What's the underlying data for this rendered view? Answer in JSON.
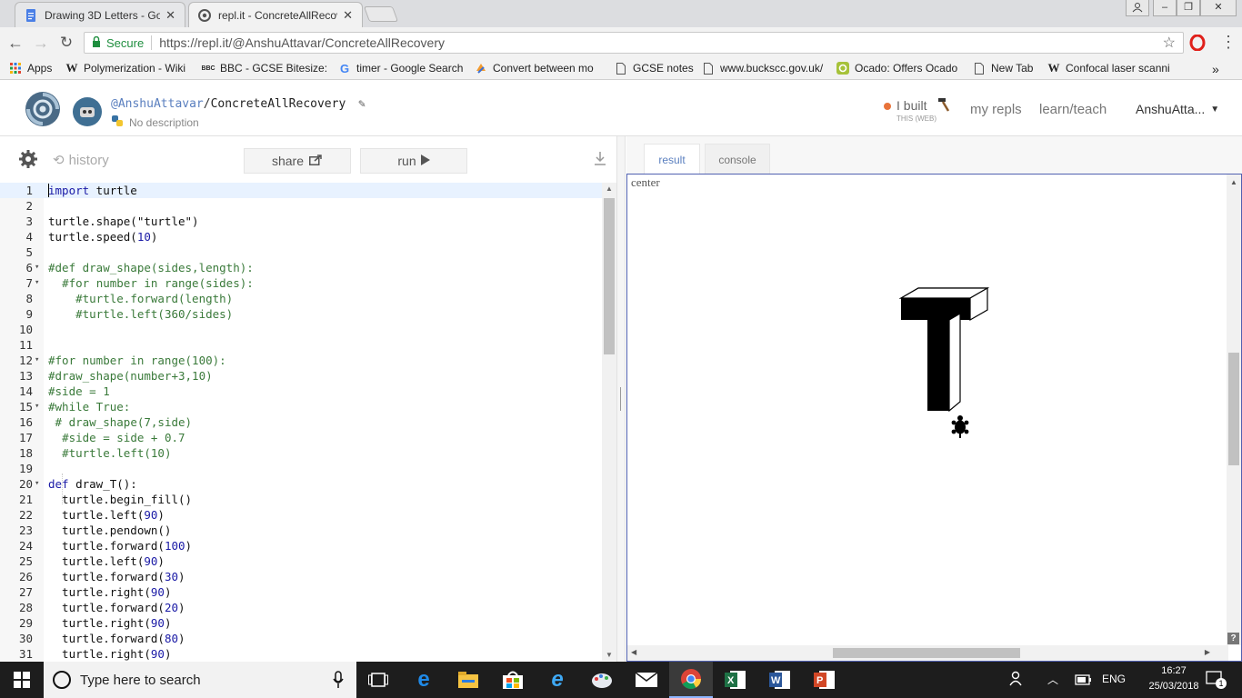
{
  "browser": {
    "tabs": [
      {
        "title": "Drawing 3D Letters - Goc",
        "close": "✕"
      },
      {
        "title": "repl.it - ConcreteAllRecov",
        "close": "✕"
      }
    ],
    "secure_label": "Secure",
    "url": "https://repl.it/@AnshuAttavar/ConcreteAllRecovery",
    "bookmarks": [
      {
        "label": "Apps",
        "icon": "apps-grid-icon"
      },
      {
        "label": "Polymerization - Wiki",
        "icon": "wikipedia-icon"
      },
      {
        "label": "BBC - GCSE Bitesize: I",
        "icon": "bbc-icon"
      },
      {
        "label": "timer - Google Search",
        "icon": "google-icon"
      },
      {
        "label": "Convert between mo",
        "icon": "convert-icon"
      },
      {
        "label": "GCSE notes",
        "icon": "page-icon"
      },
      {
        "label": "www.buckscc.gov.uk/",
        "icon": "page-icon"
      },
      {
        "label": "Ocado: Offers Ocado",
        "icon": "ocado-icon"
      },
      {
        "label": "New Tab",
        "icon": "page-icon"
      },
      {
        "label": "Confocal laser scanni",
        "icon": "wikipedia-icon"
      }
    ],
    "more_bookmarks": "»"
  },
  "repl": {
    "username": "@AnshuAttavar",
    "separator": "/",
    "repl_name": "ConcreteAllRecovery",
    "description": "No description",
    "built_label": "I built",
    "built_sub": "THIS (WEB)",
    "nav": {
      "my_repls": "my repls",
      "learn_teach": "learn/teach",
      "user": "AnshuAtta..."
    }
  },
  "editor_toolbar": {
    "history": "history",
    "share": "share",
    "run": "run"
  },
  "code_lines": [
    {
      "n": "1",
      "fold": "",
      "html": "<span class='kw'>import</span> turtle"
    },
    {
      "n": "2",
      "fold": "",
      "html": ""
    },
    {
      "n": "3",
      "fold": "",
      "html": "turtle.shape(\"turtle\")"
    },
    {
      "n": "4",
      "fold": "",
      "html": "turtle.speed(<span class='num'>10</span>)"
    },
    {
      "n": "5",
      "fold": "",
      "html": ""
    },
    {
      "n": "6",
      "fold": "▾",
      "html": "<span class='com'>#def draw_shape(sides,length):</span>"
    },
    {
      "n": "7",
      "fold": "▾",
      "html": "  <span class='com'>#for number in range(sides):</span>"
    },
    {
      "n": "8",
      "fold": "",
      "html": "    <span class='com'>#turtle.forward(length)</span>"
    },
    {
      "n": "9",
      "fold": "",
      "html": "    <span class='com'>#turtle.left(360/sides)</span>"
    },
    {
      "n": "10",
      "fold": "",
      "html": ""
    },
    {
      "n": "11",
      "fold": "",
      "html": ""
    },
    {
      "n": "12",
      "fold": "▾",
      "html": "<span class='com'>#for number in range(100):</span>"
    },
    {
      "n": "13",
      "fold": "",
      "html": "<span class='com'>#draw_shape(number+3,10)</span>"
    },
    {
      "n": "14",
      "fold": "",
      "html": "<span class='com'>#side = 1</span>"
    },
    {
      "n": "15",
      "fold": "▾",
      "html": "<span class='com'>#while True:</span>"
    },
    {
      "n": "16",
      "fold": "",
      "html": " <span class='com'># draw_shape(7,side)</span>"
    },
    {
      "n": "17",
      "fold": "",
      "html": "  <span class='com'>#side = side + 0.7</span>"
    },
    {
      "n": "18",
      "fold": "",
      "html": "  <span class='com'>#turtle.left(10)</span>"
    },
    {
      "n": "19",
      "fold": "",
      "html": ""
    },
    {
      "n": "20",
      "fold": "▾",
      "html": "<span class='kw'>def</span> draw_T():"
    },
    {
      "n": "21",
      "fold": "",
      "html": "  turtle.begin_fill()"
    },
    {
      "n": "22",
      "fold": "",
      "html": "  turtle.left(<span class='num'>90</span>)"
    },
    {
      "n": "23",
      "fold": "",
      "html": "  turtle.pendown()"
    },
    {
      "n": "24",
      "fold": "",
      "html": "  turtle.forward(<span class='num'>100</span>)"
    },
    {
      "n": "25",
      "fold": "",
      "html": "  turtle.left(<span class='num'>90</span>)"
    },
    {
      "n": "26",
      "fold": "",
      "html": "  turtle.forward(<span class='num'>30</span>)"
    },
    {
      "n": "27",
      "fold": "",
      "html": "  turtle.right(<span class='num'>90</span>)"
    },
    {
      "n": "28",
      "fold": "",
      "html": "  turtle.forward(<span class='num'>20</span>)"
    },
    {
      "n": "29",
      "fold": "",
      "html": "  turtle.right(<span class='num'>90</span>)"
    },
    {
      "n": "30",
      "fold": "",
      "html": "  turtle.forward(<span class='num'>80</span>)"
    },
    {
      "n": "31",
      "fold": "",
      "html": "  turtle.right(<span class='num'>90</span>)"
    }
  ],
  "result_panel": {
    "tabs": [
      "result",
      "console"
    ],
    "canvas_label": "center",
    "help": "?"
  },
  "taskbar": {
    "search_placeholder": "Type here to search",
    "language": "ENG",
    "time": "16:27",
    "date": "25/03/2018",
    "notifications": "1"
  },
  "colors": {
    "accent": "#5a7fbf",
    "orange_dot": "#e8733a",
    "taskbar": "#1d1d1d"
  }
}
